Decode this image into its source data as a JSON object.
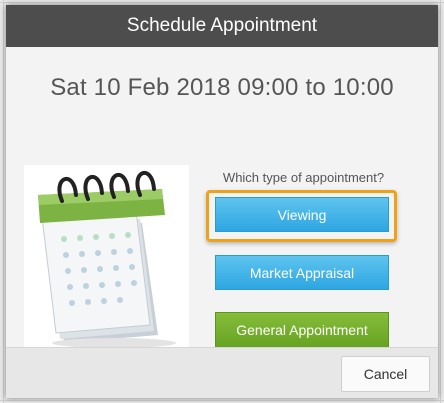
{
  "dialog": {
    "title": "Schedule Appointment",
    "date_range": "Sat 10 Feb 2018 09:00 to 10:00",
    "question": "Which type of appointment?",
    "buttons": [
      {
        "label": "Viewing",
        "color": "#3db2e8"
      },
      {
        "label": "Market Appraisal",
        "color": "#3db2e8"
      },
      {
        "label": "General Appointment",
        "color": "#72ae2b"
      }
    ],
    "cancel_label": "Cancel",
    "focus_color": "#f0a11a",
    "illustration_icon": "calendar-icon"
  }
}
